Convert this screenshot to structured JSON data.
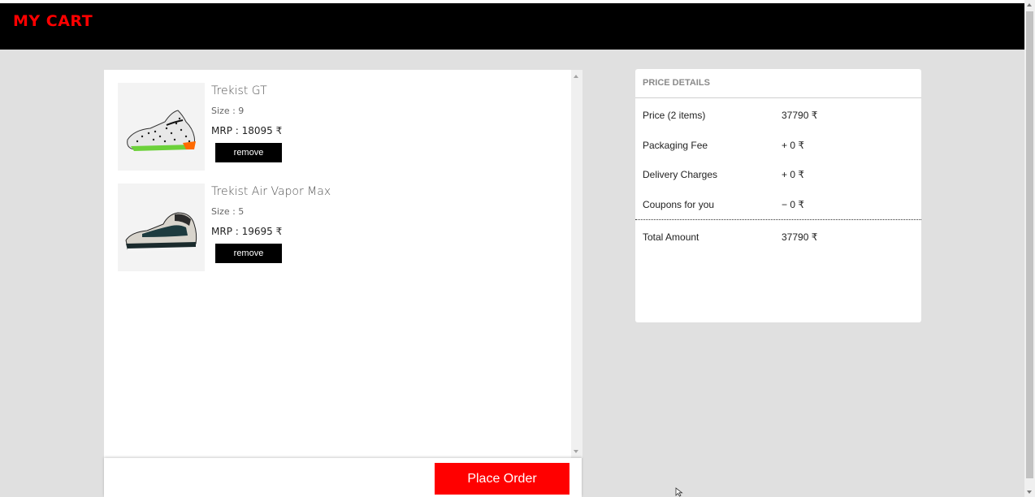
{
  "header": {
    "title": "MY CART"
  },
  "cart": {
    "items": [
      {
        "name": "Trekist GT",
        "size": "Size : 9",
        "mrp": "MRP : 18095 ₹",
        "remove_label": "remove",
        "image": "shoe-gt-icon"
      },
      {
        "name": "Trekist Air Vapor Max",
        "size": "Size : 5",
        "mrp": "MRP : 19695 ₹",
        "remove_label": "remove",
        "image": "shoe-vapor-icon"
      }
    ],
    "place_order_label": "Place Order"
  },
  "price_details": {
    "title": "PRICE DETAILS",
    "rows": [
      {
        "label": "Price (2 items)",
        "value": "37790 ₹"
      },
      {
        "label": "Packaging Fee",
        "value": "+ 0 ₹"
      },
      {
        "label": "Delivery Charges",
        "value": "+ 0 ₹"
      },
      {
        "label": "Coupons for you",
        "value": "− 0 ₹"
      }
    ],
    "total": {
      "label": "Total Amount",
      "value": "37790 ₹"
    }
  },
  "colors": {
    "brand": "#ff0000",
    "header_bg": "#000000",
    "page_bg": "#e0e0e0",
    "button_primary": "#ff0000",
    "button_secondary": "#000000"
  }
}
